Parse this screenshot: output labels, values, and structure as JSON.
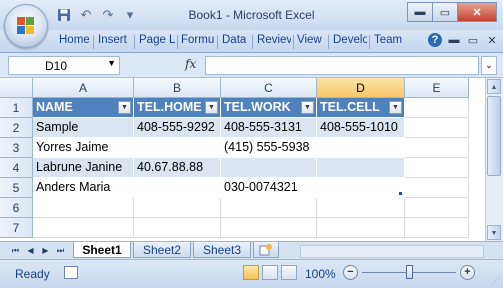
{
  "window": {
    "title": "Book1 - Microsoft Excel",
    "controls": {
      "minimize": "▬",
      "maximize": "▭",
      "close": "✕"
    }
  },
  "quick_access": {
    "icons": [
      "save-icon",
      "undo-icon",
      "redo-icon",
      "customize-icon"
    ]
  },
  "ribbon": {
    "tabs": [
      "Home",
      "Insert",
      "Page L",
      "Formu",
      "Data",
      "Reviev",
      "View",
      "Develo",
      "Team"
    ]
  },
  "formula_bar": {
    "name_box": "D10",
    "fx_label": "fx",
    "value": ""
  },
  "grid": {
    "columns": [
      "A",
      "B",
      "C",
      "D",
      "E"
    ],
    "selected_column": "D",
    "rows": [
      "1",
      "2",
      "3",
      "4",
      "5",
      "6",
      "7"
    ],
    "table": {
      "headers": [
        "NAME",
        "TEL.HOME",
        "TEL.WORK",
        "TEL.CELL"
      ],
      "rows": [
        [
          "Sample",
          "408-555-9292",
          "408-555-3131",
          "408-555-1010"
        ],
        [
          "Yorres Jaime",
          "",
          "(415) 555-5938",
          ""
        ],
        [
          "Labrune Janine",
          "40.67.88.88",
          "",
          ""
        ],
        [
          "Anders Maria",
          "",
          "030-0074321",
          ""
        ]
      ],
      "header_color": "#4f81bd",
      "band_color": "#dbe5f1"
    }
  },
  "sheets": {
    "tabs": [
      "Sheet1",
      "Sheet2",
      "Sheet3"
    ],
    "active": "Sheet1"
  },
  "status": {
    "text": "Ready",
    "zoom": "100%",
    "zoom_fraction": 0.5
  }
}
